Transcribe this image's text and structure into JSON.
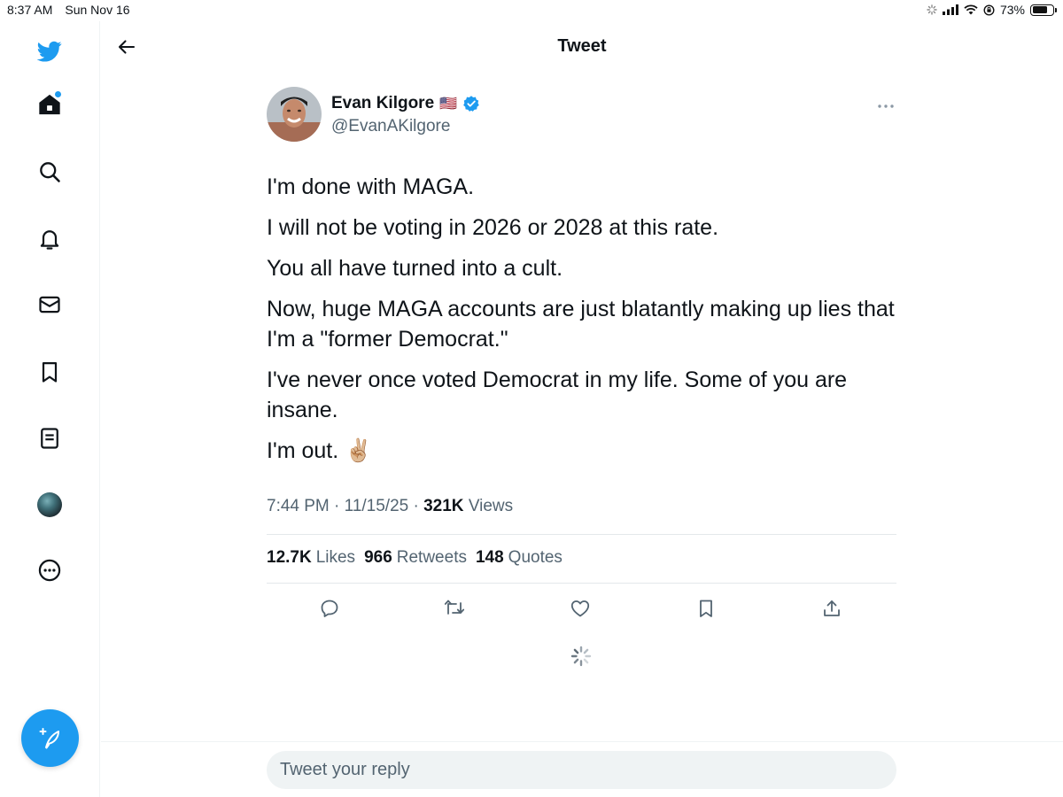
{
  "status_bar": {
    "time": "8:37 AM",
    "date": "Sun Nov 16",
    "battery": "73%",
    "battery_level": 0.73
  },
  "sidebar": {
    "items": [
      {
        "icon": "twitter-logo-icon"
      },
      {
        "icon": "home-icon",
        "has_notification_dot": true
      },
      {
        "icon": "search-icon"
      },
      {
        "icon": "notifications-bell-icon"
      },
      {
        "icon": "messages-mail-icon"
      },
      {
        "icon": "bookmark-icon"
      },
      {
        "icon": "lists-icon"
      },
      {
        "icon": "profile-avatar"
      },
      {
        "icon": "more-circle-icon"
      }
    ],
    "compose_icon": "compose-feather-icon"
  },
  "header": {
    "title": "Tweet"
  },
  "tweet": {
    "author": {
      "name": "Evan Kilgore",
      "flag": "🇺🇸",
      "handle": "@EvanAKilgore",
      "verified": true
    },
    "paragraphs": [
      "I'm done with MAGA.",
      "I will not be voting in 2026 or 2028 at this rate.",
      "You all have turned into a cult.",
      "Now, huge MAGA accounts are just blatantly making up lies that I'm a \"former Democrat.\"",
      "I've never once voted Democrat in my life. Some of you are insane.",
      "I'm out. ✌🏼"
    ],
    "time": "7:44 PM",
    "date": "11/15/25",
    "views_count": "321K",
    "views_label": "Views",
    "stats": {
      "likes_count": "12.7K",
      "likes_label": "Likes",
      "retweets_count": "966",
      "retweets_label": "Retweets",
      "quotes_count": "148",
      "quotes_label": "Quotes"
    }
  },
  "reply": {
    "placeholder": "Tweet your reply"
  },
  "colors": {
    "accent": "#1d9bf0",
    "text": "#0f1419",
    "secondary": "#536471"
  }
}
